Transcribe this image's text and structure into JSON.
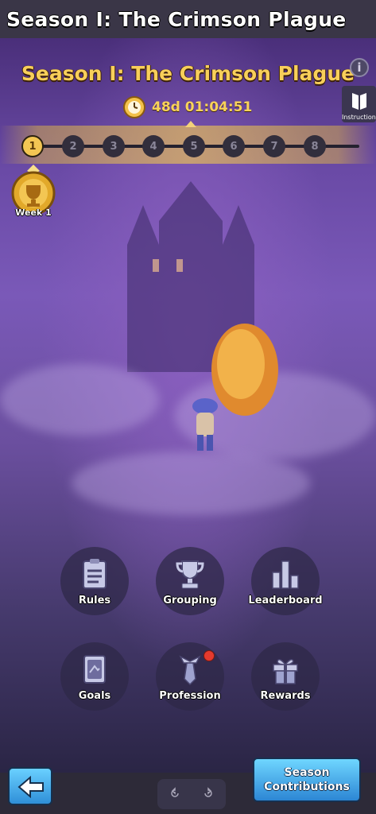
{
  "window_title": "Season I: The Crimson Plague",
  "season": {
    "title": "Season I: The Crimson Plague",
    "countdown": "48d 01:04:51",
    "info_icon": "i",
    "instructions_label": "Instructions"
  },
  "weeks": [
    "1",
    "2",
    "3",
    "4",
    "5",
    "6",
    "7",
    "8"
  ],
  "current_week": "1",
  "week_badge": "Week 1",
  "menu": {
    "rules": "Rules",
    "grouping": "Grouping",
    "leaderboard": "Leaderboard",
    "goals": "Goals",
    "profession": "Profession",
    "rewards": "Rewards"
  },
  "bottom": {
    "contrib_line1": "Season",
    "contrib_line2": "Contributions"
  },
  "colors": {
    "title_gold": "#f8cf5a",
    "accent_blue": "#2f8fd8",
    "badge_red": "#e53a2e",
    "scene_purple": "#7a59b8"
  }
}
